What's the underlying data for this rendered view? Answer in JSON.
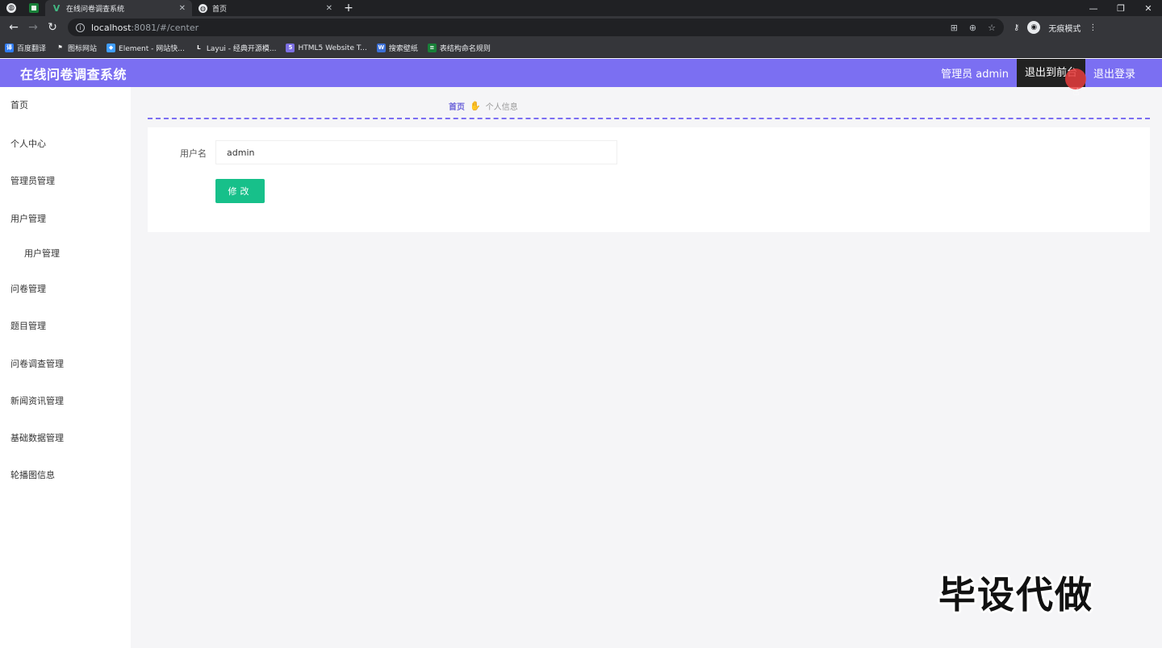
{
  "browser": {
    "tabs": [
      {
        "title": "在线问卷调查系统",
        "active": true,
        "close": "✕"
      },
      {
        "title": "首页",
        "active": false,
        "close": "✕"
      }
    ],
    "new_tab": "+",
    "window_controls": {
      "minimize": "—",
      "restore": "❐",
      "close": "✕"
    },
    "url_host": "localhost",
    "url_rest": ":8081/#/center",
    "incognito_label": "无痕模式",
    "bookmarks": [
      {
        "label": "百度翻译",
        "icon": "translate-icon",
        "color": "#2f7cf6",
        "glyph": "译"
      },
      {
        "label": "图标网站",
        "icon": "flag-icon",
        "color": "#35363a",
        "glyph": "⚑"
      },
      {
        "label": "Element - 网站快...",
        "icon": "element-icon",
        "color": "#409eff",
        "glyph": "◆"
      },
      {
        "label": "Layui - 经典开源模...",
        "icon": "layui-icon",
        "color": "#35363a",
        "glyph": "L"
      },
      {
        "label": "HTML5 Website T...",
        "icon": "html5-icon",
        "color": "#7c6fe3",
        "glyph": "5"
      },
      {
        "label": "搜索壁纸",
        "icon": "wallpaper-icon",
        "color": "#3b6fd6",
        "glyph": "W"
      },
      {
        "label": "表结构命名规则",
        "icon": "sheet-icon",
        "color": "#188038",
        "glyph": "≡"
      }
    ]
  },
  "header": {
    "title": "在线问卷调查系统",
    "user_label": "管理员 admin",
    "front_label": "退出到前台",
    "logout_label": "退出登录",
    "accent_color": "#7b6ff2"
  },
  "sidebar": {
    "items": [
      {
        "label": "首页"
      },
      {
        "label": "个人中心"
      },
      {
        "label": "管理员管理"
      },
      {
        "label": "用户管理"
      },
      {
        "label": "用户管理",
        "sub": true
      },
      {
        "label": "问卷管理"
      },
      {
        "label": "题目管理"
      },
      {
        "label": "问卷调查管理"
      },
      {
        "label": "新闻资讯管理"
      },
      {
        "label": "基础数据管理"
      },
      {
        "label": "轮播图信息"
      }
    ]
  },
  "breadcrumb": {
    "home": "首页",
    "separator_icon": "hand-icon",
    "separator_glyph": "✋",
    "current": "个人信息"
  },
  "form": {
    "username_label": "用户名",
    "username_value": "admin",
    "submit_label": "修改",
    "button_color": "#17c08a"
  },
  "watermark": "毕设代做"
}
